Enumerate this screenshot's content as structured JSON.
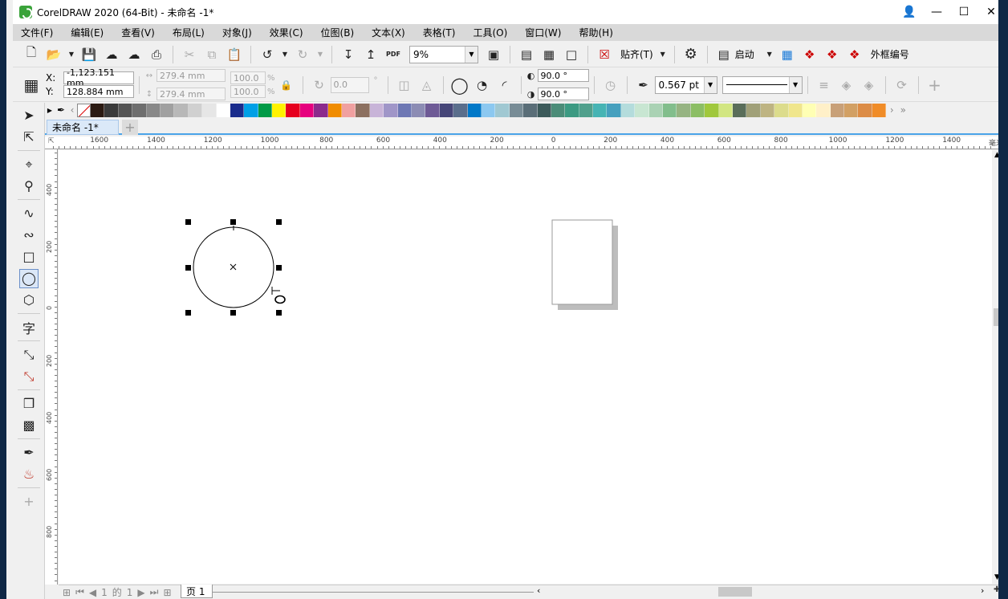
{
  "title": {
    "app": "CorelDRAW 2020 (64-Bit) - 未命名 -1*"
  },
  "menu": [
    "文件(F)",
    "编辑(E)",
    "查看(V)",
    "布局(L)",
    "对象(J)",
    "效果(C)",
    "位图(B)",
    "文本(X)",
    "表格(T)",
    "工具(O)",
    "窗口(W)",
    "帮助(H)"
  ],
  "toolbar": {
    "zoom": "9%",
    "snap_label": "贴齐(T)",
    "launch_label": "启动",
    "frame_number_label": "外框编号",
    "pdf_label": "PDF"
  },
  "props": {
    "x_label": "X:",
    "y_label": "Y:",
    "x_value": "-1,123.151 mm",
    "y_value": "128.884 mm",
    "width_value": "279.4 mm",
    "height_value": "279.4 mm",
    "scale_w": "100.0",
    "scale_h": "100.0",
    "percent": "%",
    "rotation": "0.0",
    "degree": "°",
    "start_angle": "90.0 °",
    "end_angle": "90.0 °",
    "outline_width": "0.567 pt"
  },
  "palette": [
    "#2b1a12",
    "#3a3a3a",
    "#555555",
    "#6e6e6e",
    "#888888",
    "#a0a0a0",
    "#b8b8b8",
    "#d0d0d0",
    "#e6e6e6",
    "#ffffff",
    "#1a2c8c",
    "#00a0e6",
    "#009a46",
    "#fff200",
    "#e6001e",
    "#e6007e",
    "#8c2a8c",
    "#f08c00",
    "#f0a0a0",
    "#8c7060",
    "#c8b4d8",
    "#a096c8",
    "#6e78b4",
    "#8c8cb4",
    "#6e5a96",
    "#464678",
    "#5a6e8c",
    "#0078c8",
    "#8cc8f0",
    "#a0c8d2",
    "#788c96",
    "#5a6e78",
    "#3c5a5a",
    "#4b8c78",
    "#3c9a82",
    "#50a08c",
    "#46b4b4",
    "#46a0be",
    "#b4dcdc",
    "#c8e6d2",
    "#aad2b4",
    "#82be8c",
    "#96b482",
    "#8cbe64",
    "#a0c83c",
    "#d2e682",
    "#5a6e5a",
    "#a0a078",
    "#beb482",
    "#dcdc8c",
    "#f0e68c",
    "#ffffb4",
    "#fff0c8",
    "#c8a078",
    "#d2a064",
    "#dc8c46",
    "#f08c28"
  ],
  "doc_tab": "未命名 -1*",
  "ruler": {
    "unit": "毫米",
    "h_ticks": [
      "1600",
      "1400",
      "1200",
      "1000",
      "800",
      "600",
      "400",
      "200",
      "0",
      "200",
      "400",
      "600",
      "800",
      "1000",
      "1200",
      "1400"
    ],
    "v_ticks": [
      "400",
      "200",
      "0",
      "200",
      "400",
      "600",
      "800"
    ]
  },
  "pager": {
    "current": "1",
    "of_label": "的",
    "total": "1",
    "page_tab": "页 1"
  }
}
